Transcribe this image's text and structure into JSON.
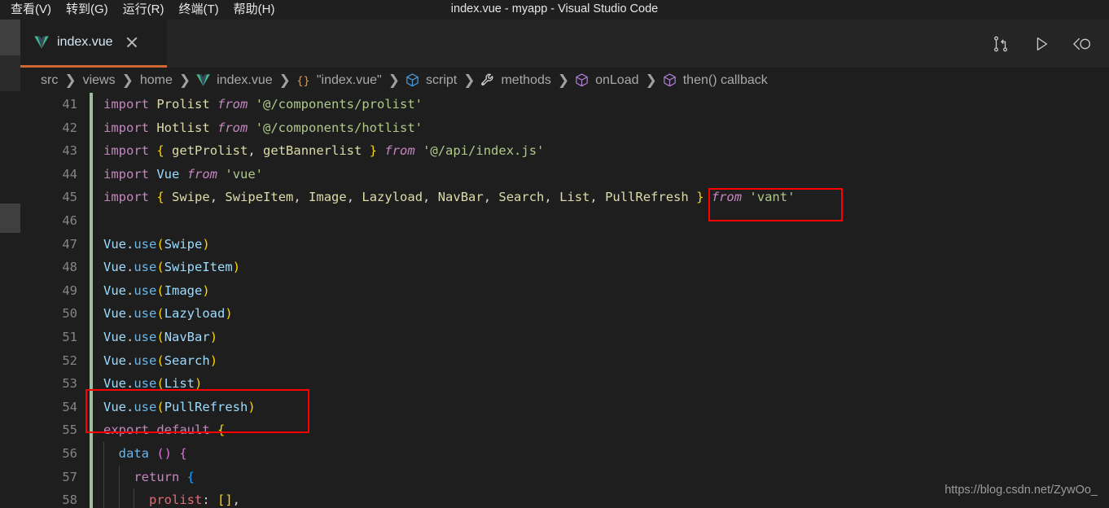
{
  "titlebar": {
    "window_title": "index.vue - myapp - Visual Studio Code",
    "menus": [
      {
        "label": "查看(V)",
        "name": "menu-view"
      },
      {
        "label": "转到(G)",
        "name": "menu-goto"
      },
      {
        "label": "运行(R)",
        "name": "menu-run"
      },
      {
        "label": "终端(T)",
        "name": "menu-terminal"
      },
      {
        "label": "帮助(H)",
        "name": "menu-help"
      }
    ]
  },
  "tabbar": {
    "active_tab": {
      "label": "index.vue",
      "icon": "vue-file-icon",
      "close_icon": "close-icon",
      "active_border_color": "#cc6633"
    },
    "actions": [
      {
        "name": "split-compare-changes-icon",
        "title": "Compare Changes"
      },
      {
        "name": "run-play-icon",
        "title": "Run"
      },
      {
        "name": "open-preview-icon",
        "title": "Open Preview"
      }
    ]
  },
  "breadcrumbs": [
    {
      "label": "src",
      "icon": null
    },
    {
      "label": "views",
      "icon": null
    },
    {
      "label": "home",
      "icon": null
    },
    {
      "label": "index.vue",
      "icon": "vue-icon"
    },
    {
      "label": "\"index.vue\"",
      "icon": "braces-icon"
    },
    {
      "label": "script",
      "icon": "blue-cube-icon"
    },
    {
      "label": "methods",
      "icon": "wrench-icon"
    },
    {
      "label": "onLoad",
      "icon": "purple-cube-icon"
    },
    {
      "label": "then() callback",
      "icon": "purple-cube-icon"
    }
  ],
  "editor": {
    "first_line_number": 41,
    "git_gutter_color": "#9bbfa0",
    "background": "#1e1e1e",
    "lines": [
      {
        "num": 41,
        "tokens": [
          {
            "t": "import",
            "c": "t-kw"
          },
          {
            "t": " ",
            "c": "t-punct"
          },
          {
            "t": "Prolist",
            "c": "t-fn"
          },
          {
            "t": " ",
            "c": "t-punct"
          },
          {
            "t": "from",
            "c": "t-kw-it"
          },
          {
            "t": " ",
            "c": "t-punct"
          },
          {
            "t": "'@/components/prolist'",
            "c": "t-str"
          }
        ]
      },
      {
        "num": 42,
        "tokens": [
          {
            "t": "import",
            "c": "t-kw"
          },
          {
            "t": " ",
            "c": "t-punct"
          },
          {
            "t": "Hotlist",
            "c": "t-fn"
          },
          {
            "t": " ",
            "c": "t-punct"
          },
          {
            "t": "from",
            "c": "t-kw-it"
          },
          {
            "t": " ",
            "c": "t-punct"
          },
          {
            "t": "'@/components/hotlist'",
            "c": "t-str"
          }
        ]
      },
      {
        "num": 43,
        "tokens": [
          {
            "t": "import",
            "c": "t-kw"
          },
          {
            "t": " ",
            "c": "t-punct"
          },
          {
            "t": "{",
            "c": "t-gold"
          },
          {
            "t": " ",
            "c": "t-punct"
          },
          {
            "t": "getProlist",
            "c": "t-fn"
          },
          {
            "t": ", ",
            "c": "t-punct"
          },
          {
            "t": "getBannerlist",
            "c": "t-fn"
          },
          {
            "t": " ",
            "c": "t-punct"
          },
          {
            "t": "}",
            "c": "t-gold"
          },
          {
            "t": " ",
            "c": "t-punct"
          },
          {
            "t": "from",
            "c": "t-kw-it"
          },
          {
            "t": " ",
            "c": "t-punct"
          },
          {
            "t": "'@/api/index.js'",
            "c": "t-str"
          }
        ]
      },
      {
        "num": 44,
        "tokens": [
          {
            "t": "import",
            "c": "t-kw"
          },
          {
            "t": " ",
            "c": "t-punct"
          },
          {
            "t": "Vue",
            "c": "t-var"
          },
          {
            "t": " ",
            "c": "t-punct"
          },
          {
            "t": "from",
            "c": "t-kw-it"
          },
          {
            "t": " ",
            "c": "t-punct"
          },
          {
            "t": "'vue'",
            "c": "t-str"
          }
        ]
      },
      {
        "num": 45,
        "tokens": [
          {
            "t": "import",
            "c": "t-kw"
          },
          {
            "t": " ",
            "c": "t-punct"
          },
          {
            "t": "{",
            "c": "t-gold"
          },
          {
            "t": " ",
            "c": "t-punct"
          },
          {
            "t": "Swipe",
            "c": "t-fn"
          },
          {
            "t": ", ",
            "c": "t-punct"
          },
          {
            "t": "SwipeItem",
            "c": "t-fn"
          },
          {
            "t": ", ",
            "c": "t-punct"
          },
          {
            "t": "Image",
            "c": "t-fn"
          },
          {
            "t": ", ",
            "c": "t-punct"
          },
          {
            "t": "Lazyload",
            "c": "t-fn"
          },
          {
            "t": ", ",
            "c": "t-punct"
          },
          {
            "t": "NavBar",
            "c": "t-fn"
          },
          {
            "t": ", ",
            "c": "t-punct"
          },
          {
            "t": "Search",
            "c": "t-fn"
          },
          {
            "t": ", ",
            "c": "t-punct"
          },
          {
            "t": "List",
            "c": "t-fn"
          },
          {
            "t": ", ",
            "c": "t-punct"
          },
          {
            "t": "PullRefresh",
            "c": "t-fn"
          },
          {
            "t": " ",
            "c": "t-punct"
          },
          {
            "t": "}",
            "c": "t-gold"
          },
          {
            "t": " ",
            "c": "t-punct"
          },
          {
            "t": "from",
            "c": "t-kw-it"
          },
          {
            "t": " ",
            "c": "t-punct"
          },
          {
            "t": "'vant'",
            "c": "t-str"
          }
        ]
      },
      {
        "num": 46,
        "tokens": []
      },
      {
        "num": 47,
        "tokens": [
          {
            "t": "Vue",
            "c": "t-var"
          },
          {
            "t": ".",
            "c": "t-punct"
          },
          {
            "t": "use",
            "c": "t-var2"
          },
          {
            "t": "(",
            "c": "t-gold"
          },
          {
            "t": "Swipe",
            "c": "t-var"
          },
          {
            "t": ")",
            "c": "t-gold"
          }
        ]
      },
      {
        "num": 48,
        "tokens": [
          {
            "t": "Vue",
            "c": "t-var"
          },
          {
            "t": ".",
            "c": "t-punct"
          },
          {
            "t": "use",
            "c": "t-var2"
          },
          {
            "t": "(",
            "c": "t-gold"
          },
          {
            "t": "SwipeItem",
            "c": "t-var"
          },
          {
            "t": ")",
            "c": "t-gold"
          }
        ]
      },
      {
        "num": 49,
        "tokens": [
          {
            "t": "Vue",
            "c": "t-var"
          },
          {
            "t": ".",
            "c": "t-punct"
          },
          {
            "t": "use",
            "c": "t-var2"
          },
          {
            "t": "(",
            "c": "t-gold"
          },
          {
            "t": "Image",
            "c": "t-var"
          },
          {
            "t": ")",
            "c": "t-gold"
          }
        ]
      },
      {
        "num": 50,
        "tokens": [
          {
            "t": "Vue",
            "c": "t-var"
          },
          {
            "t": ".",
            "c": "t-punct"
          },
          {
            "t": "use",
            "c": "t-var2"
          },
          {
            "t": "(",
            "c": "t-gold"
          },
          {
            "t": "Lazyload",
            "c": "t-var"
          },
          {
            "t": ")",
            "c": "t-gold"
          }
        ]
      },
      {
        "num": 51,
        "tokens": [
          {
            "t": "Vue",
            "c": "t-var"
          },
          {
            "t": ".",
            "c": "t-punct"
          },
          {
            "t": "use",
            "c": "t-var2"
          },
          {
            "t": "(",
            "c": "t-gold"
          },
          {
            "t": "NavBar",
            "c": "t-var"
          },
          {
            "t": ")",
            "c": "t-gold"
          }
        ]
      },
      {
        "num": 52,
        "tokens": [
          {
            "t": "Vue",
            "c": "t-var"
          },
          {
            "t": ".",
            "c": "t-punct"
          },
          {
            "t": "use",
            "c": "t-var2"
          },
          {
            "t": "(",
            "c": "t-gold"
          },
          {
            "t": "Search",
            "c": "t-var"
          },
          {
            "t": ")",
            "c": "t-gold"
          }
        ]
      },
      {
        "num": 53,
        "tokens": [
          {
            "t": "Vue",
            "c": "t-var"
          },
          {
            "t": ".",
            "c": "t-punct"
          },
          {
            "t": "use",
            "c": "t-var2"
          },
          {
            "t": "(",
            "c": "t-gold"
          },
          {
            "t": "List",
            "c": "t-var"
          },
          {
            "t": ")",
            "c": "t-gold"
          }
        ]
      },
      {
        "num": 54,
        "tokens": [
          {
            "t": "Vue",
            "c": "t-var"
          },
          {
            "t": ".",
            "c": "t-punct"
          },
          {
            "t": "use",
            "c": "t-var2"
          },
          {
            "t": "(",
            "c": "t-gold"
          },
          {
            "t": "PullRefresh",
            "c": "t-var"
          },
          {
            "t": ")",
            "c": "t-gold"
          }
        ]
      },
      {
        "num": 55,
        "tokens": [
          {
            "t": "export",
            "c": "t-kw"
          },
          {
            "t": " ",
            "c": "t-punct"
          },
          {
            "t": "default",
            "c": "t-kw"
          },
          {
            "t": " ",
            "c": "t-punct"
          },
          {
            "t": "{",
            "c": "t-gold"
          }
        ]
      },
      {
        "num": 56,
        "tokens": [
          {
            "t": "  ",
            "c": "t-punct"
          },
          {
            "t": "data",
            "c": "t-var2"
          },
          {
            "t": " ",
            "c": "t-punct"
          },
          {
            "t": "()",
            "c": "t-pink"
          },
          {
            "t": " ",
            "c": "t-punct"
          },
          {
            "t": "{",
            "c": "t-pink"
          }
        ]
      },
      {
        "num": 57,
        "tokens": [
          {
            "t": "    ",
            "c": "t-punct"
          },
          {
            "t": "return",
            "c": "t-kw"
          },
          {
            "t": " ",
            "c": "t-punct"
          },
          {
            "t": "{",
            "c": "t-blue"
          }
        ]
      },
      {
        "num": 58,
        "tokens": [
          {
            "t": "      ",
            "c": "t-punct"
          },
          {
            "t": "prolist",
            "c": "t-prop"
          },
          {
            "t": ": ",
            "c": "t-punct"
          },
          {
            "t": "[]",
            "c": "t-gold"
          },
          {
            "t": ",",
            "c": "t-punct"
          }
        ]
      }
    ]
  },
  "annotations": [
    {
      "name": "highlight-pullrefresh-import",
      "target": "PullRefresh import",
      "color": "#ff0000"
    },
    {
      "name": "highlight-pullrefresh-use",
      "target": "Vue.use(PullRefresh)",
      "color": "#ff0000"
    }
  ],
  "watermark": {
    "text": "https://blog.csdn.net/ZywOo_"
  }
}
